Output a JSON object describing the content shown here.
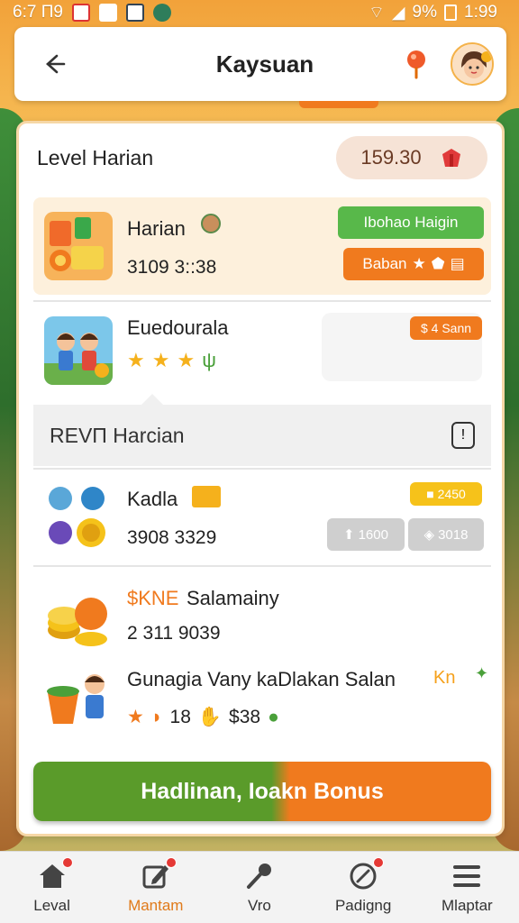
{
  "status_bar": {
    "time_left": "6:7 Π9",
    "battery": "9%",
    "time": "1:99"
  },
  "header": {
    "title": "Kaysuan"
  },
  "level": {
    "title": "Level Harian",
    "amount": "159.30"
  },
  "rows": [
    {
      "title": "Harian",
      "subtitle": "3109 3::38",
      "button_green": "Ibohao Haigin",
      "button_orange": "Baban"
    },
    {
      "title": "Euedourala",
      "badge": "$ 4 Sann"
    }
  ],
  "section": {
    "title": "REVΠ Harcian"
  },
  "row3": {
    "title": "Kadla",
    "subtitle": "3908 3329",
    "badge": "2450",
    "chip1": "1600",
    "chip2": "3018"
  },
  "row4": {
    "title_prefix": "$KNE",
    "title": "Salamainy",
    "subtitle": "2 311 9039"
  },
  "row5": {
    "title": "Gunagia Vany kaDlakan Salan",
    "title_suffix": "Kn",
    "num1": "18",
    "num2": "$38"
  },
  "cta": {
    "label": "Hadlinan, Ioakn Bonus"
  },
  "nav": [
    {
      "label": "Leval",
      "icon": "home-icon",
      "active": false
    },
    {
      "label": "Mantam",
      "icon": "edit-icon",
      "active": true
    },
    {
      "label": "Vro",
      "icon": "mic-icon",
      "active": false
    },
    {
      "label": "Padigng",
      "icon": "compass-icon",
      "active": false
    },
    {
      "label": "Mlaptar",
      "icon": "menu-icon",
      "active": false
    }
  ],
  "colors": {
    "accent_orange": "#f07a1e",
    "accent_green": "#58b84a",
    "badge_yellow": "#f6c21a",
    "cta_green": "#5a9b2a"
  }
}
